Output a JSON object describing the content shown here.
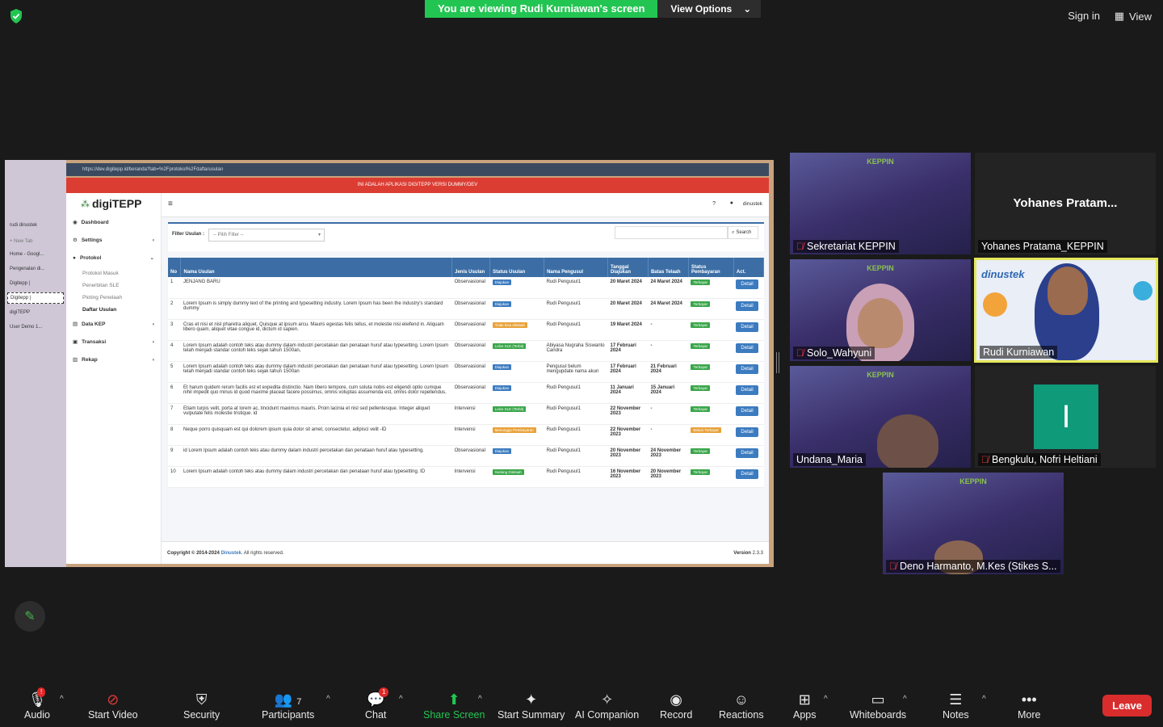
{
  "banner": {
    "viewing": "You are viewing Rudi Kurniawan's screen",
    "view_options": "View Options"
  },
  "topright": {
    "sign_in": "Sign in",
    "view": "View"
  },
  "shared": {
    "url": "https://dev.digitepp.id/beranda?tab=%2Fprotokol%2Fdaftarusulan",
    "notice": "INI ADALAH APLIKASI DIGITEPP VERSI DUMMY/DEV",
    "logo": "digiTEPP",
    "user": "dinustek",
    "help": "?",
    "browser_tabs": [
      "rudi dinustek",
      "+ New Tab",
      "Home - Googl...",
      "Pengenalan di...",
      "Digitepp |",
      "Digitepp |",
      "digiTEPP",
      "User Demo 1..."
    ],
    "menu": {
      "dashboard": "Dashboard",
      "settings": "Settings",
      "protokol": "Protokol",
      "protokol_masuk": "Protokol Masuk",
      "penerbitan_sle": "Penerbitan SLE",
      "ploting_penelaah": "Ploting Penelaah",
      "daftar_usulan": "Daftar Usulan",
      "data_kep": "Data KEP",
      "transaksi": "Transaksi",
      "rekap": "Rekap"
    },
    "filter_label": "Filter Usulan :",
    "filter_placeholder": "-- Pilih Filter --",
    "search_label": "Search",
    "headers": [
      "No",
      "Nama Usulan",
      "Jenis Usulan",
      "Status Usulan",
      "Nama Pengusul",
      "Tanggal Diajukan",
      "Batas Telaah",
      "Status Pembayaran",
      "Act."
    ],
    "rows": [
      {
        "no": "1",
        "nama": "JENJANG BARU",
        "jenis": "Observasional",
        "status": "Diajukan",
        "status_color": "#3c7bbf",
        "pengusul": "Rudi Pengusul1",
        "tgl": "20 Maret 2024",
        "batas": "24 Maret 2024",
        "bayar": "Terbayar",
        "bayar_color": "#3aa64a",
        "act": "Detail"
      },
      {
        "no": "2",
        "nama": "Lorem Ipsum is simply dummy text of the printing and typesetting industry. Lorem Ipsum has been the industry's standard dummy",
        "jenis": "Observasional",
        "status": "Diajukan",
        "status_color": "#3c7bbf",
        "pengusul": "Rudi Pengusul1",
        "tgl": "20 Maret 2024",
        "batas": "24 Maret 2024",
        "bayar": "Terbayar",
        "bayar_color": "#3aa64a",
        "act": "Detail"
      },
      {
        "no": "3",
        "nama": "Cras et nisi et nisl pharetra aliquet. Quisque at ipsum arcu. Mauris egestas felis tellus, et molestie nisi eleifend in. Aliquam libero quam, aliquet vitae congue id, dictum id sapien.",
        "jenis": "Observasional",
        "status": "Tidak bisa ditelaah",
        "status_color": "#e8a23a",
        "pengusul": "Rudi Pengusul1",
        "tgl": "19 Maret 2024",
        "batas": "-",
        "bayar": "Terbayar",
        "bayar_color": "#3aa64a",
        "act": "Detail"
      },
      {
        "no": "4",
        "nama": "Lorem Ipsum adalah contoh teks atau dummy dalam industri percetakan dan penataan huruf atau typesetting. Lorem Ipsum telah menjadi standar contoh teks sejak tahun 1500an,",
        "jenis": "Observasional",
        "status": "Lolos SLE (Terbit)",
        "status_color": "#3aa64a",
        "pengusul": "Abiyasa Nugraha Siswanto Candra",
        "tgl": "17 Februari 2024",
        "batas": "-",
        "bayar": "Terbayar",
        "bayar_color": "#3aa64a",
        "act": "Detail"
      },
      {
        "no": "5",
        "nama": "Lorem Ipsum adalah contoh teks atau dummy dalam industri percetakan dan penataan huruf atau typesetting. Lorem Ipsum telah menjadi standar contoh teks sejak tahun 1500an",
        "jenis": "Observasional",
        "status": "Diajukan",
        "status_color": "#3c7bbf",
        "pengusul": "Pengusul belum mengupdate nama akun",
        "tgl": "17 Februari 2024",
        "batas": "21 Februari 2024",
        "bayar": "Terbayar",
        "bayar_color": "#3aa64a",
        "act": "Detail"
      },
      {
        "no": "6",
        "nama": "Et harum quidem rerum facilis est et expedita distinctio. Nam libero tempore, cum soluta nobis est eligendi optio cumque nihil impedit quo minus id quod maxime placeat facere possimus, omnis voluptas assumenda est, omnis dolor repellendus.",
        "jenis": "Observasional",
        "status": "Diajukan",
        "status_color": "#3c7bbf",
        "pengusul": "Rudi Pengusul1",
        "tgl": "11 Januari 2024",
        "batas": "15 Januari 2024",
        "bayar": "Terbayar",
        "bayar_color": "#3aa64a",
        "act": "Detail"
      },
      {
        "no": "7",
        "nama": "Etiam turpis velit, porta at lorem ac, tincidunt maximus mauris. Proin lacinia et nisl sed pellentesque. Integer aliquet vulputate felis molestie tristique. id",
        "jenis": "Intervensi",
        "status": "Lolos SLE (Terbit)",
        "status_color": "#3aa64a",
        "pengusul": "Rudi Pengusul1",
        "tgl": "22 November 2023",
        "batas": "-",
        "bayar": "Terbayar",
        "bayar_color": "#3aa64a",
        "act": "Detail"
      },
      {
        "no": "8",
        "nama": "Neque porro quisquam est qui dolorem ipsum quia dolor sit amet, consectetur, adipisci velit -ID",
        "jenis": "Intervensi",
        "status": "Menunggu Pembayaran",
        "status_color": "#e8a23a",
        "pengusul": "Rudi Pengusul1",
        "tgl": "22 November 2023",
        "batas": "-",
        "bayar": "Belum Terbayar",
        "bayar_color": "#e8a23a",
        "act": "Detail"
      },
      {
        "no": "9",
        "nama": "id Lorem Ipsum adalah contoh teks atau dummy dalam industri percetakan dan penataan huruf atau typesetting.",
        "jenis": "Observasional",
        "status": "Diajukan",
        "status_color": "#3c7bbf",
        "pengusul": "Rudi Pengusul1",
        "tgl": "20 November 2023",
        "batas": "24 November 2023",
        "bayar": "Terbayar",
        "bayar_color": "#3aa64a",
        "act": "Detail"
      },
      {
        "no": "10",
        "nama": "Lorem Ipsum adalah contoh teks atau dummy dalam industri percetakan dan penataan huruf atau typesetting. ID",
        "jenis": "Intervensi",
        "status": "Sedang Ditelaah",
        "status_color": "#3aa64a",
        "pengusul": "Rudi Pengusul1",
        "tgl": "16 November 2023",
        "batas": "20 November 2023",
        "bayar": "Terbayar",
        "bayar_color": "#3aa64a",
        "act": "Detail"
      }
    ],
    "footer_copyright": "Copyright © 2014-2024",
    "footer_company": "Dinustek",
    "footer_rights": ". All rights reserved.",
    "footer_version_label": "Version",
    "footer_version": "2.3.3"
  },
  "participants": [
    {
      "name": "Sekretariat KEPPIN",
      "muted": true
    },
    {
      "name": "Yohanes Pratama_KEPPIN",
      "big_name": "Yohanes  Pratam...",
      "muted": false
    },
    {
      "name": "Solo_Wahyuni",
      "muted": true
    },
    {
      "name": "Rudi Kurniawan",
      "muted": false,
      "brand": "dinustek"
    },
    {
      "name": "Undana_Maria",
      "muted": false
    },
    {
      "name": "Bengkulu, Nofri Heltiani",
      "muted": true,
      "initial": "I"
    },
    {
      "name": "Deno Harmanto, M.Kes (Stikes S...",
      "muted": true
    }
  ],
  "keppin_text": "KEPPIN",
  "toolbar": {
    "audio": "Audio",
    "audio_badge": "!",
    "start_video": "Start Video",
    "security": "Security",
    "participants": "Participants",
    "participants_count": "7",
    "chat": "Chat",
    "chat_badge": "1",
    "share_screen": "Share Screen",
    "start_summary": "Start Summary",
    "ai_companion": "AI Companion",
    "record": "Record",
    "reactions": "Reactions",
    "apps": "Apps",
    "whiteboards": "Whiteboards",
    "notes": "Notes",
    "more": "More",
    "leave": "Leave"
  }
}
